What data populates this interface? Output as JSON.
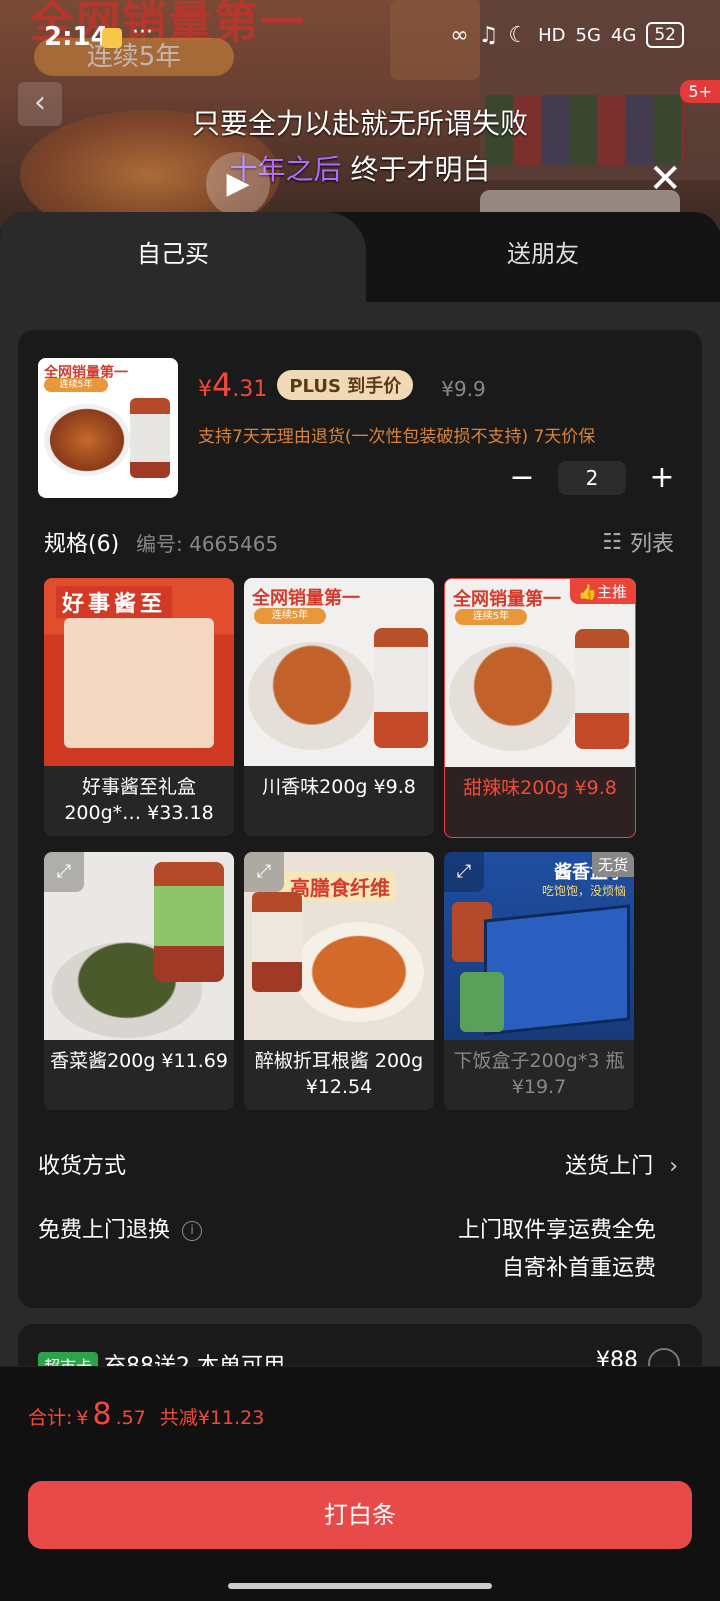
{
  "status_bar": {
    "time": "2:14",
    "dots": "···",
    "network1": "HD",
    "network2": "5G",
    "network3": "4G",
    "battery": "52"
  },
  "video": {
    "banner_text": "全网销量第一",
    "banner_pill": "连续5年",
    "badge": "5+",
    "lyric_line1": "只要全力以赴就无所谓失败",
    "lyric_line2_highlight": "十年之后",
    "lyric_line2_rest": " 终于才明白"
  },
  "tabs": {
    "self": "自己买",
    "friend": "送朋友"
  },
  "product": {
    "thumb_title": "全网销量第一",
    "thumb_pill": "连续5年",
    "price_symbol": "¥",
    "price_int": "4",
    "price_dec": ".31",
    "plus_tag": "PLUS 到手价",
    "orig_price": "¥9.9",
    "policy": "支持7天无理由退货(一次性包装破损不支持)  7天价保",
    "quantity": "2",
    "minus": "−",
    "plus": "+"
  },
  "spec": {
    "title": "规格(6)",
    "code": "编号: 4665465",
    "list_label": "列表",
    "items": [
      {
        "label": "好事酱至礼盒 200g*… ¥33.18",
        "tag": ""
      },
      {
        "label": "川香味200g ¥9.8",
        "tag": ""
      },
      {
        "label": "甜辣味200g ¥9.8",
        "tag": "主推"
      },
      {
        "label": "香菜酱200g ¥11.69",
        "tag": ""
      },
      {
        "label": "醉椒折耳根酱 200g ¥12.54",
        "tag": ""
      },
      {
        "label": "下饭盒子200g*3 瓶 ¥19.7",
        "tag": "无货"
      }
    ],
    "img_text": {
      "gift_title": "好事酱至",
      "food_header": "全网销量第一",
      "food_pill": "连续5年",
      "noodle_header": "高膳食纤维",
      "box_header": "酱香盒子",
      "box_sub": "吃饱饱，没烦恼"
    }
  },
  "delivery": {
    "label": "收货方式",
    "value": "送货上门"
  },
  "returns": {
    "label": "免费上门退换",
    "value_line1": "上门取件享运费全免",
    "value_line2": "自寄补首重运费"
  },
  "coupon": {
    "tag": "超市卡",
    "text": "充88送2   本单可用",
    "amount": "¥88"
  },
  "footer": {
    "total_label": "合计:",
    "total_symbol": "¥",
    "total_int": "8",
    "total_dec": ".57",
    "saved": "共减¥11.23",
    "pay_button": "打白条"
  },
  "colors": {
    "accent": "#e84a4a",
    "price_red": "#f24a3a",
    "policy_orange": "#d9843a"
  }
}
